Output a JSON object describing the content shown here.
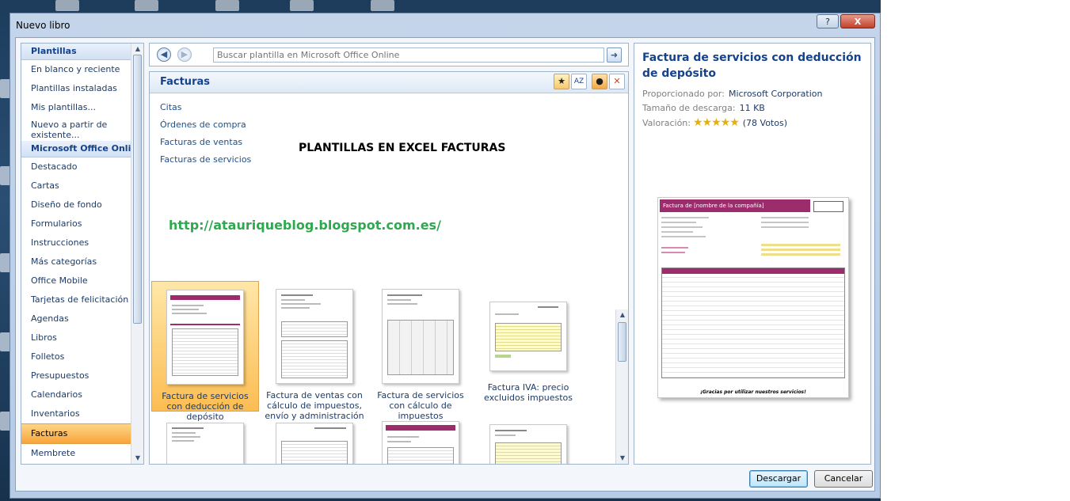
{
  "window": {
    "title": "Nuevo libro",
    "help_label": "?",
    "close_label": "X"
  },
  "sidebar": {
    "section_templates": "Plantillas",
    "local_items": [
      {
        "label": "En blanco y reciente"
      },
      {
        "label": "Plantillas instaladas"
      },
      {
        "label": "Mis plantillas..."
      },
      {
        "label": "Nuevo a partir de existente..."
      }
    ],
    "section_online": "Microsoft Office Online",
    "online_items": [
      {
        "label": "Destacado"
      },
      {
        "label": "Cartas"
      },
      {
        "label": "Diseño de fondo"
      },
      {
        "label": "Formularios"
      },
      {
        "label": "Instrucciones"
      },
      {
        "label": "Más categorías"
      },
      {
        "label": "Office Mobile"
      },
      {
        "label": "Tarjetas de felicitación"
      },
      {
        "label": "Agendas"
      },
      {
        "label": "Libros"
      },
      {
        "label": "Folletos"
      },
      {
        "label": "Presupuestos"
      },
      {
        "label": "Calendarios"
      },
      {
        "label": "Inventarios"
      },
      {
        "label": "Facturas",
        "selected": true
      },
      {
        "label": "Membrete"
      }
    ]
  },
  "search": {
    "placeholder": "Buscar plantilla en Microsoft Office Online"
  },
  "center": {
    "title": "Facturas",
    "subcategories": [
      {
        "label": "Citas"
      },
      {
        "label": "Órdenes de compra"
      },
      {
        "label": "Facturas de ventas"
      },
      {
        "label": "Facturas de servicios"
      }
    ],
    "banner": "PLANTILLAS EN EXCEL FACTURAS",
    "blog_url": "http://atauriqueblog.blogspot.com.es/",
    "templates": [
      {
        "label": "Factura de servicios con deducción de depósito",
        "selected": true
      },
      {
        "label": "Factura de ventas con cálculo de impuestos, envío y administración"
      },
      {
        "label": "Factura de servicios con cálculo de impuestos"
      },
      {
        "label": "Factura IVA: precio excluidos impuestos"
      }
    ]
  },
  "details": {
    "title": "Factura de servicios con deducción de depósito",
    "provided_by_label": "Proporcionado por:",
    "provided_by_value": "Microsoft Corporation",
    "download_size_label": "Tamaño de descarga:",
    "download_size_value": "11 KB",
    "rating_label": "Valoración:",
    "rating_value": 5,
    "rating_votes": "(78 Votos)",
    "preview_heading": "Factura de [nombre de la compañía]",
    "preview_footer": "¡Gracias por utilizar nuestros servicios!"
  },
  "buttons": {
    "download": "Descargar",
    "cancel": "Cancelar"
  },
  "colors": {
    "accent_blue": "#15428b",
    "selection_orange": "#f8a43a",
    "template_magenta": "#9c2c6b",
    "url_green": "#2fa84f"
  }
}
